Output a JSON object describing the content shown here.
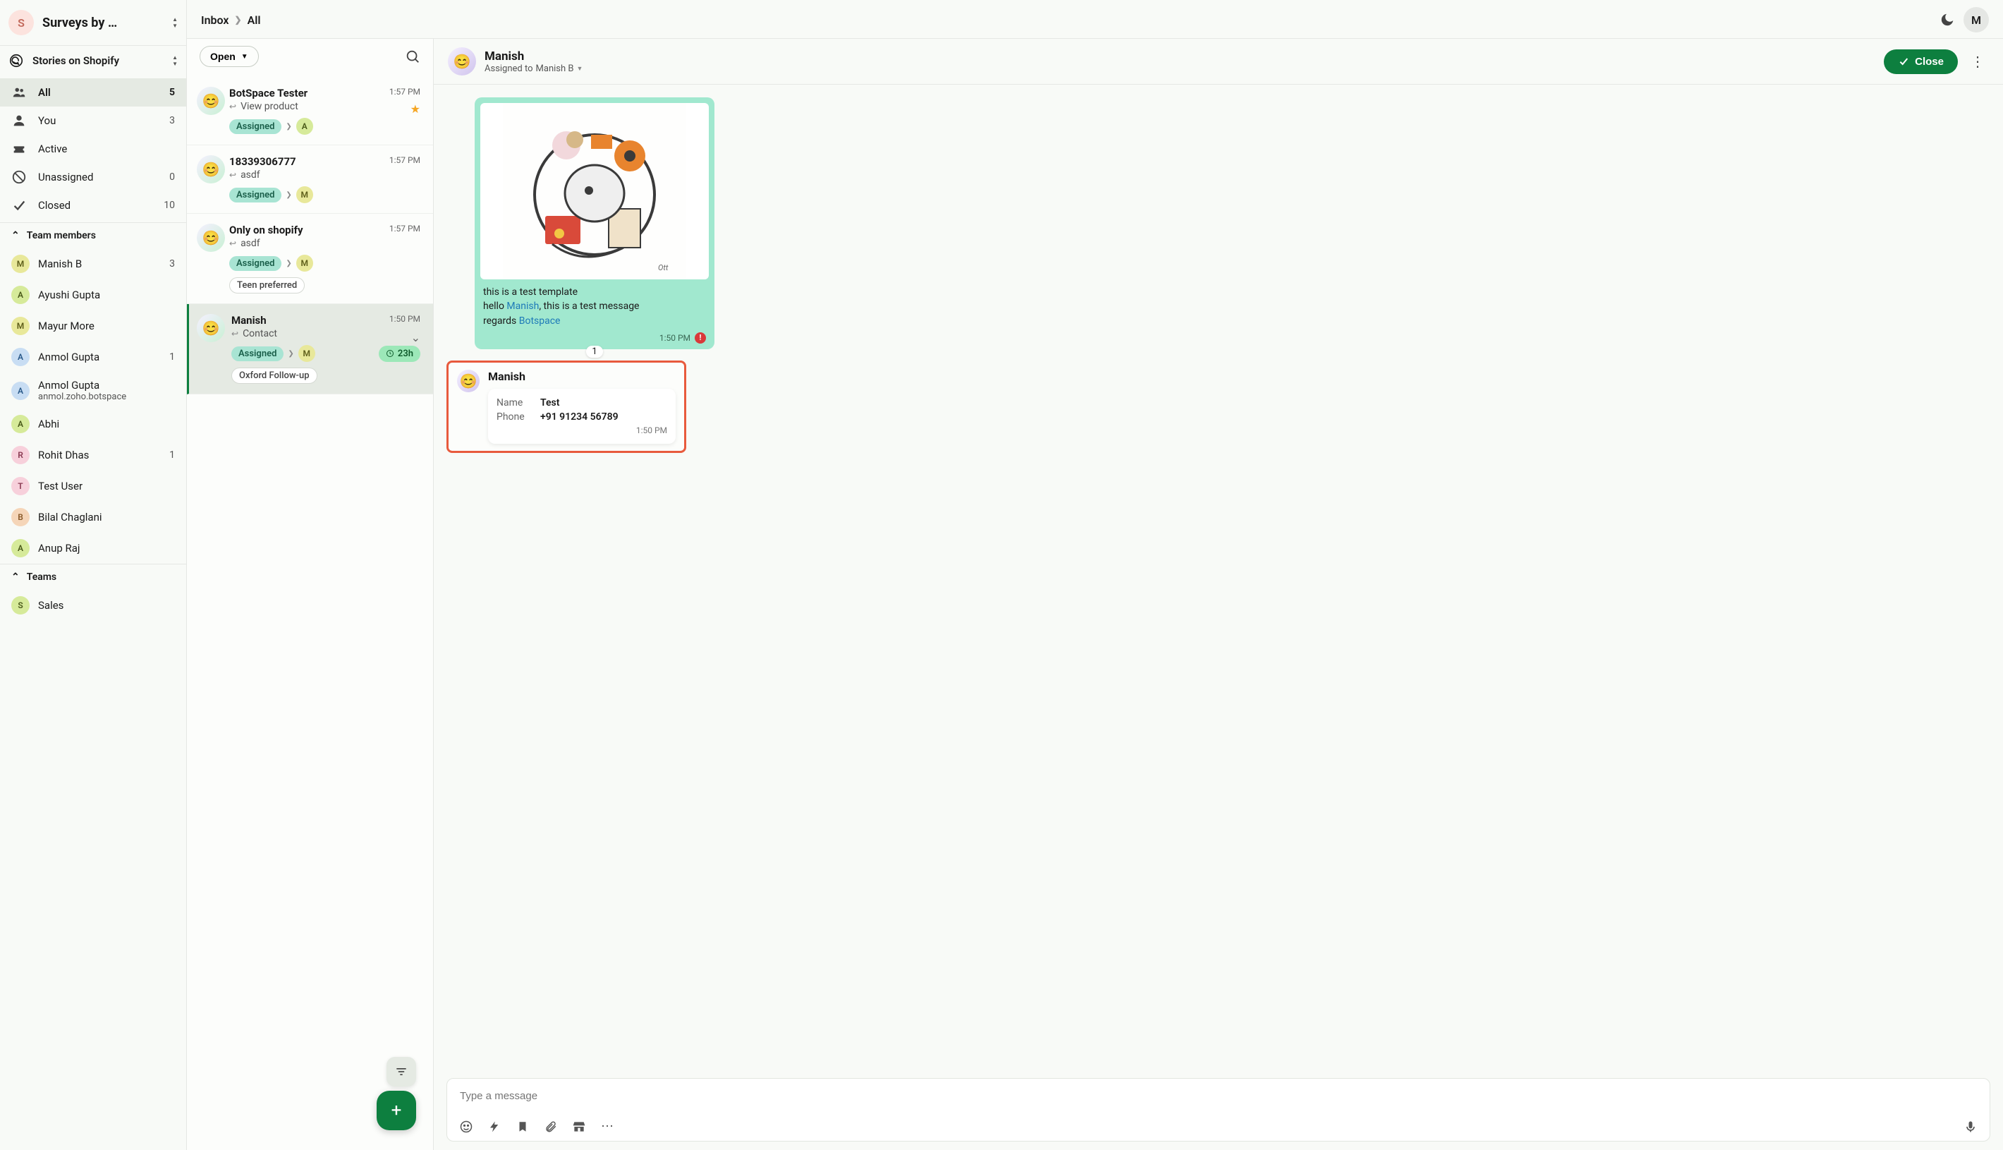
{
  "workspace": {
    "badge": "S",
    "name": "Surveys by …"
  },
  "channel": {
    "name": "Stories on Shopify"
  },
  "nav": {
    "all": {
      "label": "All",
      "count": "5"
    },
    "you": {
      "label": "You",
      "count": "3"
    },
    "active": {
      "label": "Active",
      "count": ""
    },
    "unassigned": {
      "label": "Unassigned",
      "count": "0"
    },
    "closed": {
      "label": "Closed",
      "count": "10"
    }
  },
  "sections": {
    "team_members": "Team members",
    "teams": "Teams"
  },
  "members": [
    {
      "initial": "M",
      "pal": "pal-yellow",
      "name": "Manish B",
      "count": "3"
    },
    {
      "initial": "A",
      "pal": "pal-lime",
      "name": "Ayushi Gupta",
      "count": ""
    },
    {
      "initial": "M",
      "pal": "pal-yellow",
      "name": "Mayur More",
      "count": ""
    },
    {
      "initial": "A",
      "pal": "pal-blue",
      "name": "Anmol Gupta",
      "count": "1"
    },
    {
      "initial": "A",
      "pal": "pal-blue",
      "name": "Anmol Gupta",
      "sub": "anmol.zoho.botspace",
      "count": ""
    },
    {
      "initial": "A",
      "pal": "pal-lime",
      "name": "Abhi",
      "count": ""
    },
    {
      "initial": "R",
      "pal": "pal-pink",
      "name": "Rohit Dhas",
      "count": "1"
    },
    {
      "initial": "T",
      "pal": "pal-pink",
      "name": "Test User",
      "count": ""
    },
    {
      "initial": "B",
      "pal": "pal-orange",
      "name": "Bilal Chaglani",
      "count": ""
    },
    {
      "initial": "A",
      "pal": "pal-lime",
      "name": "Anup Raj",
      "count": ""
    }
  ],
  "teams": [
    {
      "initial": "S",
      "pal": "pal-lime",
      "name": "Sales"
    }
  ],
  "breadcrumb": {
    "inbox": "Inbox",
    "current": "All"
  },
  "top_user_badge": "M",
  "convo_toolbar": {
    "open": "Open"
  },
  "conversations": [
    {
      "name": "BotSpace Tester",
      "time": "1:57 PM",
      "preview": "View product",
      "starred": true,
      "assigned_label": "Assigned",
      "assignee_initial": "A",
      "assignee_pal": "pal-lime",
      "avatar_pal": "pal-green"
    },
    {
      "name": "18339306777",
      "time": "1:57 PM",
      "preview": "asdf",
      "assigned_label": "Assigned",
      "assignee_initial": "M",
      "assignee_pal": "pal-yellow",
      "avatar_pal": "pal-green"
    },
    {
      "name": "Only on shopify",
      "time": "1:57 PM",
      "preview": "asdf",
      "assigned_label": "Assigned",
      "assignee_initial": "M",
      "assignee_pal": "pal-yellow",
      "tag": "Teen preferred",
      "avatar_pal": "pal-green"
    },
    {
      "name": "Manish",
      "time": "1:50 PM",
      "preview": "Contact",
      "collapsible": true,
      "assigned_label": "Assigned",
      "assignee_initial": "M",
      "assignee_pal": "pal-yellow",
      "sla": "23h",
      "tag": "Oxford Follow-up",
      "avatar_pal": "pal-purple",
      "selected": true
    }
  ],
  "chat": {
    "contact_name": "Manish",
    "assigned_to_prefix": "Assigned to ",
    "assigned_to": "Manish B",
    "close_label": "Close",
    "template_msg": {
      "line1": "this is a test template",
      "line2a": "hello ",
      "line2b": "Manish",
      "line2c": ", this is a test message",
      "line3a": "regards ",
      "line3b": "Botspace",
      "time": "1:50 PM",
      "reaction_count": "1"
    },
    "contact_card": {
      "header": "Manish",
      "name_label": "Name",
      "name_value": "Test",
      "phone_label": "Phone",
      "phone_value": "+91 91234 56789",
      "time": "1:50 PM"
    }
  },
  "composer": {
    "placeholder": "Type a message"
  }
}
